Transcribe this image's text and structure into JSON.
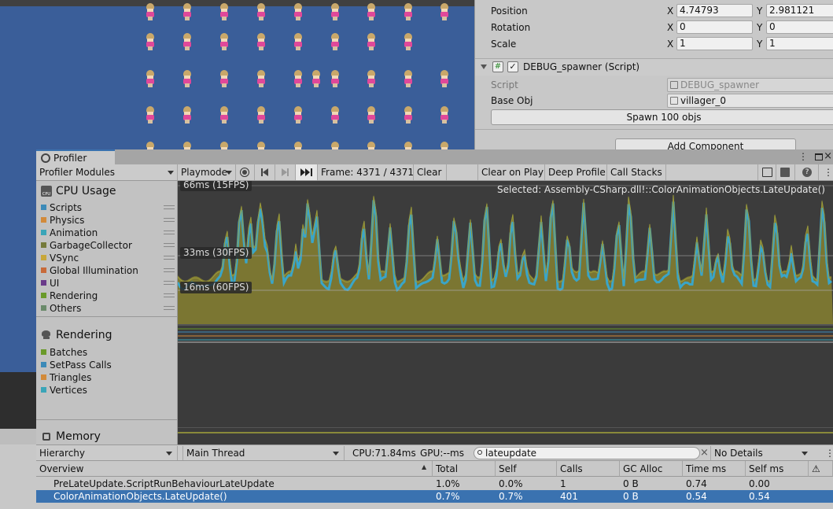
{
  "inspector": {
    "position": {
      "label": "Position",
      "x_axis": "X",
      "x": "4.74793",
      "y_axis": "Y",
      "y": "2.981121"
    },
    "rotation": {
      "label": "Rotation",
      "x_axis": "X",
      "x": "0",
      "y_axis": "Y",
      "y": "0"
    },
    "scale": {
      "label": "Scale",
      "x_axis": "X",
      "x": "1",
      "y_axis": "Y",
      "y": "1"
    },
    "component": {
      "title": "DEBUG_spawner (Script)",
      "script_label": "Script",
      "script_value": "DEBUG_spawner",
      "base_obj_label": "Base Obj",
      "base_obj_value": "villager_0",
      "spawn_button": "Spawn 100 objs"
    },
    "add_component_button": "Add Component"
  },
  "profiler": {
    "tab_title": "Profiler",
    "toolbar": {
      "modules_dropdown": "Profiler Modules",
      "target_dropdown": "Playmode",
      "frame_label": "Frame: 4371 / 4371",
      "clear": "Clear",
      "clear_on_play": "Clear on Play",
      "deep_profile": "Deep Profile",
      "call_stacks": "Call Stacks"
    },
    "modules": {
      "cpu": {
        "title": "CPU Usage",
        "icon_text": "CPU",
        "legend": [
          {
            "label": "Scripts",
            "color": "#3c8ab8"
          },
          {
            "label": "Physics",
            "color": "#d28a3a"
          },
          {
            "label": "Animation",
            "color": "#3aa5b8"
          },
          {
            "label": "GarbageCollector",
            "color": "#757a3a"
          },
          {
            "label": "VSync",
            "color": "#c8a73a"
          },
          {
            "label": "Global Illumination",
            "color": "#c86a3a"
          },
          {
            "label": "UI",
            "color": "#6a3a8a"
          },
          {
            "label": "Rendering",
            "color": "#6a9a2a"
          },
          {
            "label": "Others",
            "color": "#6a8a6a"
          }
        ]
      },
      "rendering": {
        "title": "Rendering",
        "legend": [
          {
            "label": "Batches",
            "color": "#6a9a2a"
          },
          {
            "label": "SetPass Calls",
            "color": "#3c8ab8"
          },
          {
            "label": "Triangles",
            "color": "#d28a3a"
          },
          {
            "label": "Vertices",
            "color": "#3aa5b8"
          }
        ]
      },
      "memory": {
        "title": "Memory"
      }
    },
    "chart": {
      "fps_labels": [
        "66ms (15FPS)",
        "33ms (30FPS)",
        "16ms (60FPS)"
      ],
      "selected": "Selected: Assembly-CSharp.dll!::ColorAnimationObjects.LateUpdate()"
    },
    "details": {
      "view_dropdown": "Hierarchy",
      "thread_dropdown": "Main Thread",
      "cpu_time": "CPU:71.84ms",
      "gpu_time": "GPU:--ms",
      "search_value": "lateupdate",
      "details_dropdown": "No Details"
    },
    "table": {
      "columns": [
        "Overview",
        "Total",
        "Self",
        "Calls",
        "GC Alloc",
        "Time ms",
        "Self ms"
      ],
      "rows": [
        [
          "PreLateUpdate.ScriptRunBehaviourLateUpdate",
          "1.0%",
          "0.0%",
          "1",
          "0 B",
          "0.74",
          "0.00"
        ],
        [
          "ColorAnimationObjects.LateUpdate()",
          "0.7%",
          "0.7%",
          "401",
          "0 B",
          "0.54",
          "0.54"
        ]
      ]
    }
  }
}
